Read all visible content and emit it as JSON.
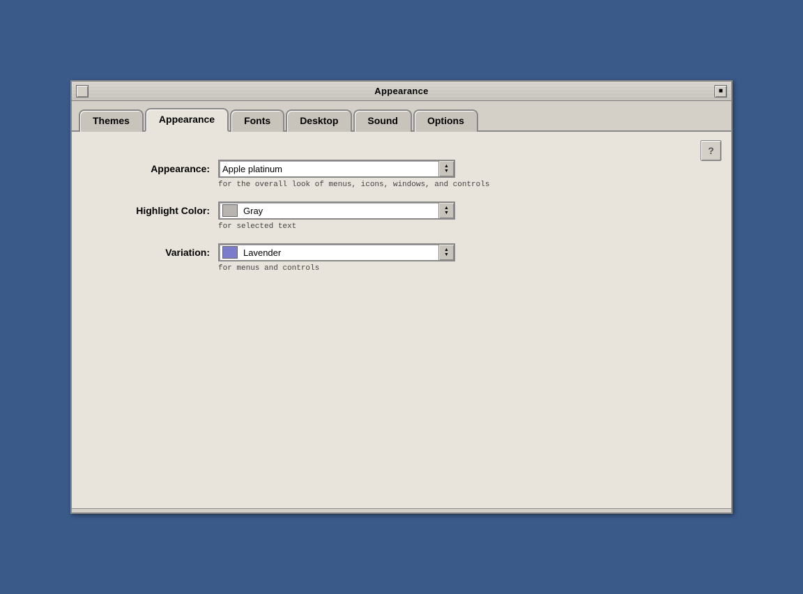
{
  "window": {
    "title": "Appearance",
    "close_label": "",
    "zoom_label": "▪"
  },
  "tabs": [
    {
      "id": "themes",
      "label": "Themes",
      "active": false
    },
    {
      "id": "appearance",
      "label": "Appearance",
      "active": true
    },
    {
      "id": "fonts",
      "label": "Fonts",
      "active": false
    },
    {
      "id": "desktop",
      "label": "Desktop",
      "active": false
    },
    {
      "id": "sound",
      "label": "Sound",
      "active": false
    },
    {
      "id": "options",
      "label": "Options",
      "active": false
    }
  ],
  "help_button_label": "?",
  "form": {
    "appearance": {
      "label": "Appearance:",
      "value": "Apple platinum",
      "hint": "for the overall look of menus, icons, windows, and controls"
    },
    "highlight_color": {
      "label": "Highlight Color:",
      "value": "Gray",
      "hint": "for selected text",
      "swatch_color": "#b8b4b0",
      "swatch_class": "swatch-gray"
    },
    "variation": {
      "label": "Variation:",
      "value": "Lavender",
      "hint": "for menus and controls",
      "swatch_color": "#7b7ccc",
      "swatch_class": "swatch-lavender"
    }
  },
  "icons": {
    "arrow_up": "▲",
    "arrow_down": "▼"
  }
}
